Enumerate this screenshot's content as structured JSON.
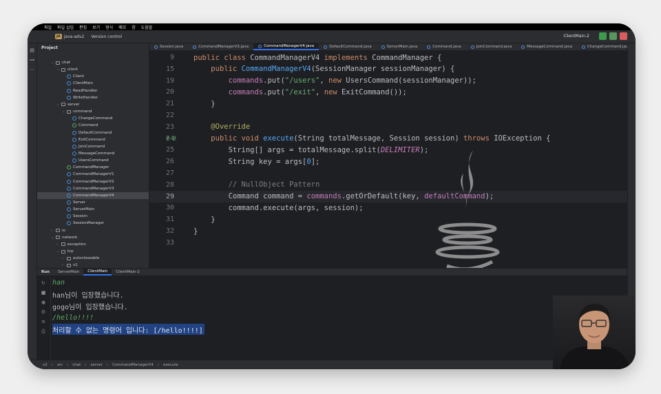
{
  "menubar": [
    "파일",
    "파일 삽입",
    "편집",
    "보기",
    "형식",
    "메모",
    "창",
    "도움말"
  ],
  "titlebar": {
    "project_badge": "JA",
    "project_name": "java-adv2",
    "version_control": "Version control",
    "run_config": "ClientMain-2"
  },
  "project_panel": {
    "title": "Project",
    "items": [
      {
        "label": "chat",
        "depth": 1,
        "kind": "folder",
        "open": true
      },
      {
        "label": "client",
        "depth": 2,
        "kind": "folder",
        "open": true
      },
      {
        "label": "Client",
        "depth": 3,
        "kind": "class"
      },
      {
        "label": "ClientMain",
        "depth": 3,
        "kind": "class"
      },
      {
        "label": "ReadHandler",
        "depth": 3,
        "kind": "class"
      },
      {
        "label": "WriteHandler",
        "depth": 3,
        "kind": "class"
      },
      {
        "label": "server",
        "depth": 2,
        "kind": "folder",
        "open": true
      },
      {
        "label": "command",
        "depth": 3,
        "kind": "folder",
        "open": true
      },
      {
        "label": "ChangeCommand",
        "depth": 4,
        "kind": "class"
      },
      {
        "label": "Command",
        "depth": 4,
        "kind": "iface"
      },
      {
        "label": "DefaultCommand",
        "depth": 4,
        "kind": "class"
      },
      {
        "label": "ExitCommand",
        "depth": 4,
        "kind": "class"
      },
      {
        "label": "JoinCommand",
        "depth": 4,
        "kind": "class"
      },
      {
        "label": "MessageCommand",
        "depth": 4,
        "kind": "class"
      },
      {
        "label": "UsersCommand",
        "depth": 4,
        "kind": "class"
      },
      {
        "label": "CommandManager",
        "depth": 3,
        "kind": "iface"
      },
      {
        "label": "CommandManagerV1",
        "depth": 3,
        "kind": "class"
      },
      {
        "label": "CommandManagerV2",
        "depth": 3,
        "kind": "class"
      },
      {
        "label": "CommandManagerV3",
        "depth": 3,
        "kind": "class"
      },
      {
        "label": "CommandManagerV4",
        "depth": 3,
        "kind": "class",
        "selected": true
      },
      {
        "label": "Server",
        "depth": 3,
        "kind": "class"
      },
      {
        "label": "ServerMain",
        "depth": 3,
        "kind": "class"
      },
      {
        "label": "Session",
        "depth": 3,
        "kind": "class"
      },
      {
        "label": "SessionManager",
        "depth": 3,
        "kind": "class"
      },
      {
        "label": "io",
        "depth": 1,
        "kind": "folder",
        "open": false
      },
      {
        "label": "network",
        "depth": 1,
        "kind": "folder",
        "open": true
      },
      {
        "label": "exception",
        "depth": 2,
        "kind": "folder",
        "open": false
      },
      {
        "label": "tcp",
        "depth": 2,
        "kind": "folder",
        "open": true
      },
      {
        "label": "autocloseable",
        "depth": 3,
        "kind": "folder",
        "open": false
      },
      {
        "label": "v1",
        "depth": 3,
        "kind": "folder",
        "open": false
      }
    ]
  },
  "tabs": [
    {
      "label": "Session.java",
      "active": false
    },
    {
      "label": "CommandManagerV3.java",
      "active": false
    },
    {
      "label": "CommandManagerV4.java",
      "active": true
    },
    {
      "label": "DefaultCommand.java",
      "active": false
    },
    {
      "label": "ServerMain.java",
      "active": false
    },
    {
      "label": "Command.java",
      "active": false
    },
    {
      "label": "JoinCommand.java",
      "active": false
    },
    {
      "label": "MessageCommand.java",
      "active": false
    },
    {
      "label": "ChangeCommand.java",
      "active": false
    }
  ],
  "code": [
    {
      "n": "9",
      "segs": [
        [
          "kw",
          "public class "
        ],
        [
          "",
          "CommandManagerV4 "
        ],
        [
          "kw",
          "implements "
        ],
        [
          "",
          "CommandManager {"
        ]
      ]
    },
    {
      "n": "15",
      "segs": [
        [
          "",
          "    "
        ],
        [
          "kw",
          "public "
        ],
        [
          "fn",
          "CommandManagerV4"
        ],
        [
          "",
          "(SessionManager sessionManager) {"
        ]
      ]
    },
    {
      "n": "19",
      "segs": [
        [
          "",
          "        "
        ],
        [
          "field",
          "commands"
        ],
        [
          "",
          ".put("
        ],
        [
          "str",
          "\"/users\""
        ],
        [
          "",
          ", "
        ],
        [
          "kw",
          "new "
        ],
        [
          "",
          "UsersCommand(sessionManager));"
        ]
      ]
    },
    {
      "n": "20",
      "segs": [
        [
          "",
          "        "
        ],
        [
          "field",
          "commands"
        ],
        [
          "",
          ".put("
        ],
        [
          "str",
          "\"/exit\""
        ],
        [
          "",
          ", "
        ],
        [
          "kw",
          "new "
        ],
        [
          "",
          "ExitCommand());"
        ]
      ]
    },
    {
      "n": "21",
      "segs": [
        [
          "",
          "    }"
        ]
      ]
    },
    {
      "n": "22",
      "segs": [
        [
          "",
          ""
        ]
      ]
    },
    {
      "n": "23",
      "segs": [
        [
          "",
          "    "
        ],
        [
          "ann",
          "@Override"
        ]
      ]
    },
    {
      "n": "24",
      "segs": [
        [
          "",
          "    "
        ],
        [
          "kw",
          "public void "
        ],
        [
          "fn",
          "execute"
        ],
        [
          "",
          "(String totalMessage, Session session) "
        ],
        [
          "kw",
          "throws "
        ],
        [
          "",
          "IOException {"
        ]
      ]
    },
    {
      "n": "25",
      "segs": [
        [
          "",
          "        String[] args = totalMessage.split("
        ],
        [
          "const",
          "DELIMITER"
        ],
        [
          "",
          ");"
        ]
      ]
    },
    {
      "n": "26",
      "segs": [
        [
          "",
          "        String key = args["
        ],
        [
          "fn",
          "0"
        ],
        [
          "",
          "];"
        ]
      ]
    },
    {
      "n": "27",
      "segs": [
        [
          "",
          ""
        ]
      ]
    },
    {
      "n": "28",
      "segs": [
        [
          "",
          "        "
        ],
        [
          "cmt",
          "// NullObject Pattern"
        ]
      ]
    },
    {
      "n": "29",
      "segs": [
        [
          "",
          "        Command command = "
        ],
        [
          "field",
          "commands"
        ],
        [
          "",
          ".getOrDefault(key, "
        ],
        [
          "field",
          "defaultCommand"
        ],
        [
          "",
          ");"
        ]
      ]
    },
    {
      "n": "30",
      "segs": [
        [
          "",
          "        command.execute(args, session);"
        ]
      ]
    },
    {
      "n": "31",
      "segs": [
        [
          "",
          "    }"
        ]
      ]
    },
    {
      "n": "32",
      "segs": [
        [
          "",
          "}"
        ]
      ]
    },
    {
      "n": "33",
      "segs": [
        [
          "",
          ""
        ]
      ]
    }
  ],
  "run_panel": {
    "label": "Run",
    "tabs": [
      {
        "label": "ServerMain",
        "active": false
      },
      {
        "label": "ClientMain",
        "active": true
      },
      {
        "label": "ClientMain-2",
        "active": false
      }
    ]
  },
  "console": [
    {
      "text": "han",
      "kind": "input"
    },
    {
      "text": "han님이 입장했습니다.",
      "kind": "out"
    },
    {
      "text": "gogo님이 입장했습니다.",
      "kind": "out"
    },
    {
      "text": "/hello!!!!",
      "kind": "input"
    },
    {
      "text": "처리할 수 없는 명령어 입니다: [/hello!!!!]",
      "kind": "sel"
    }
  ],
  "statusbar": [
    "v2",
    "src",
    "chat",
    "server",
    "CommandManagerV4",
    "execute"
  ],
  "colors": {
    "accent": "#3574f0",
    "bg": "#1e1f22",
    "panel": "#2b2d30"
  }
}
